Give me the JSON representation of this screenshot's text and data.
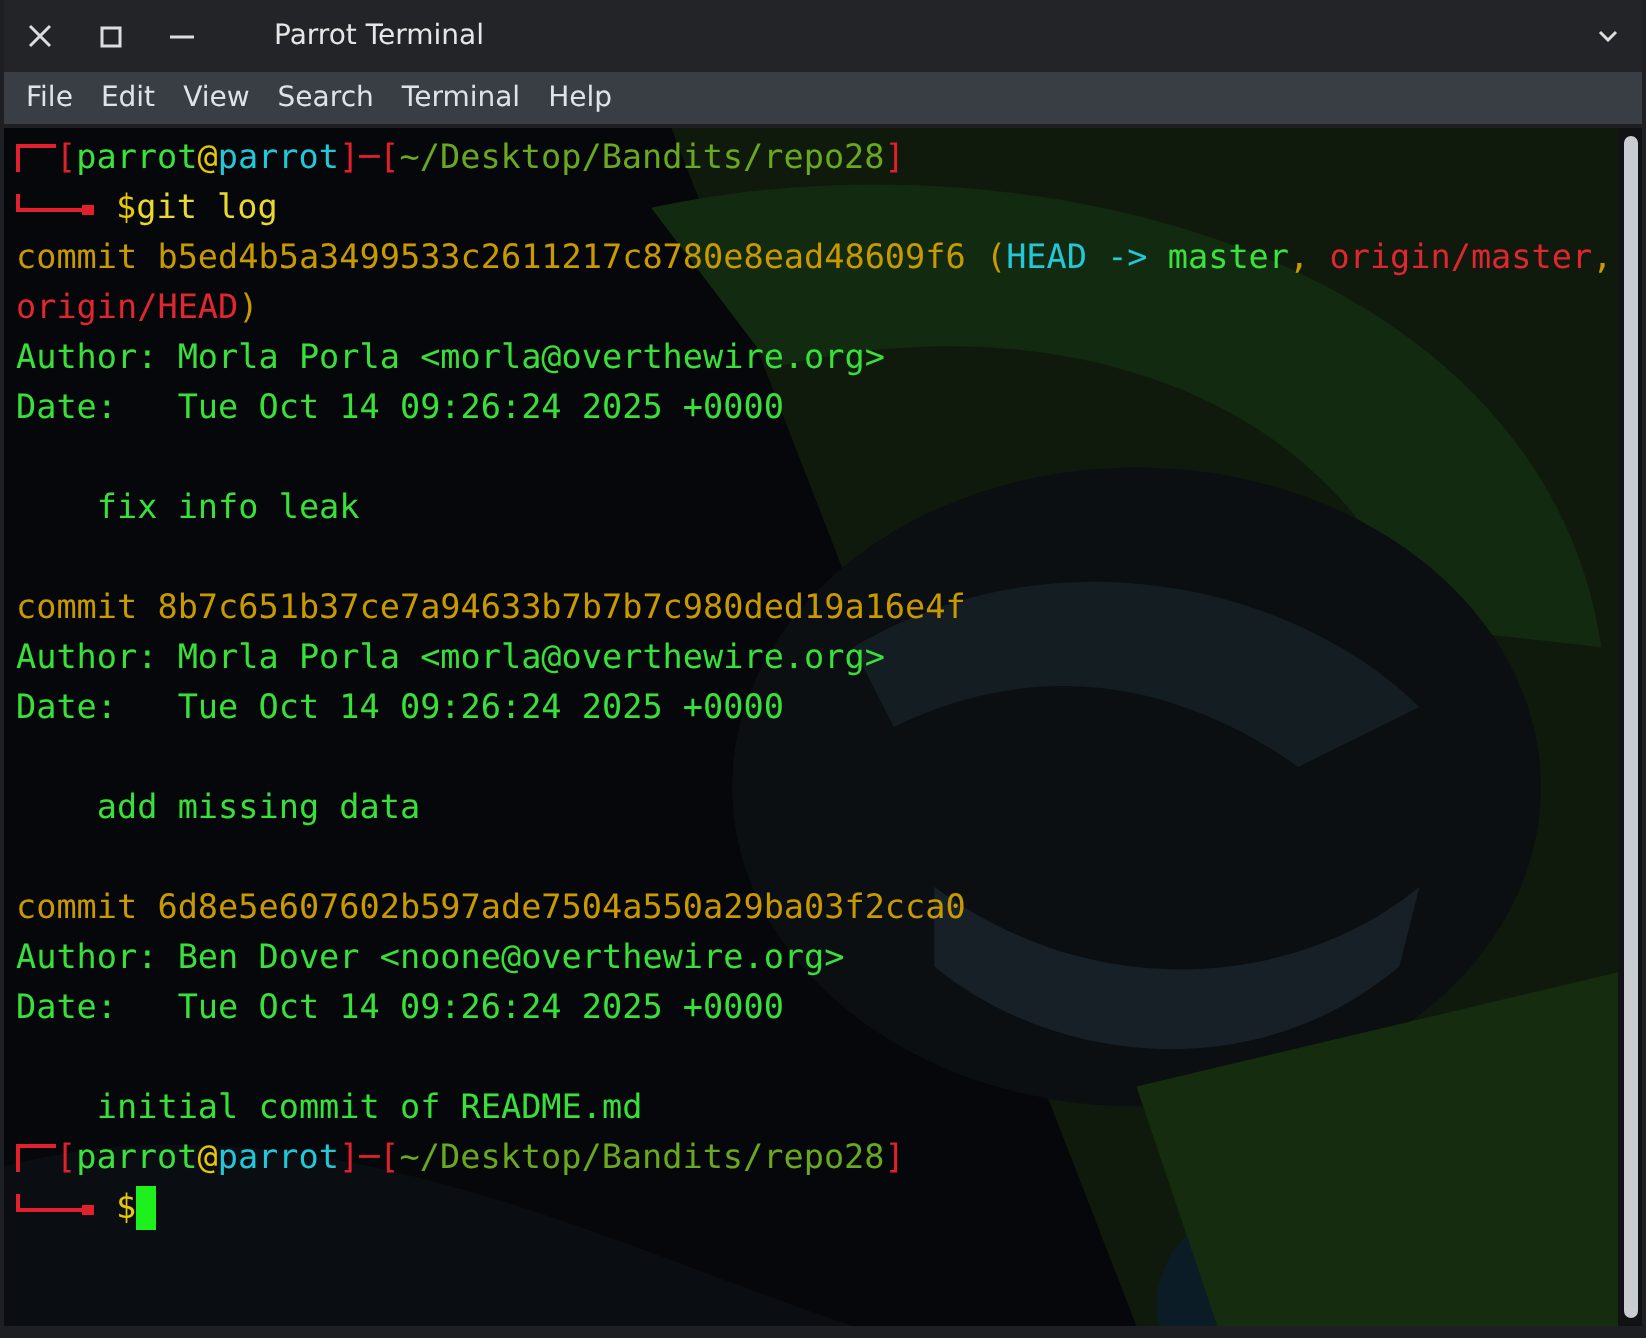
{
  "window": {
    "title": "Parrot Terminal"
  },
  "menu": [
    "File",
    "Edit",
    "View",
    "Search",
    "Terminal",
    "Help"
  ],
  "lines": [
    {
      "kind": "prompt-top",
      "segments": [
        {
          "kind": "frame",
          "text": "["
        },
        {
          "kind": "user",
          "text": "parrot"
        },
        {
          "kind": "at",
          "text": "@"
        },
        {
          "kind": "host",
          "text": "parrot"
        },
        {
          "kind": "frame",
          "text": "]─["
        },
        {
          "kind": "path",
          "text": "~/Desktop/Bandits/repo28"
        },
        {
          "kind": "frame",
          "text": "]"
        }
      ]
    },
    {
      "kind": "prompt-cmd",
      "segments": [
        {
          "kind": "at",
          "text": "$"
        },
        {
          "kind": "command",
          "text": "git log"
        }
      ]
    },
    {
      "kind": "text",
      "segments": [
        {
          "kind": "commit",
          "text": "commit b5ed4b5a3499533c2611217c8780e8ead48609f6 ("
        },
        {
          "kind": "host",
          "text": "HEAD -> "
        },
        {
          "kind": "user",
          "text": "master"
        },
        {
          "kind": "commit",
          "text": ", "
        },
        {
          "kind": "remote",
          "text": "origin/master"
        },
        {
          "kind": "commit",
          "text": ","
        }
      ]
    },
    {
      "kind": "text",
      "segments": [
        {
          "kind": "remote",
          "text": "origin/HEAD"
        },
        {
          "kind": "commit",
          "text": ")"
        }
      ]
    },
    {
      "kind": "text",
      "segments": [
        {
          "kind": "plain",
          "text": "Author: Morla Porla <morla@overthewire.org>"
        }
      ]
    },
    {
      "kind": "text",
      "segments": [
        {
          "kind": "plain",
          "text": "Date:   Tue Oct 14 09:26:24 2025 +0000"
        }
      ]
    },
    {
      "kind": "blank"
    },
    {
      "kind": "text",
      "segments": [
        {
          "kind": "plain",
          "text": "    fix info leak"
        }
      ]
    },
    {
      "kind": "blank"
    },
    {
      "kind": "text",
      "segments": [
        {
          "kind": "commit",
          "text": "commit 8b7c651b37ce7a94633b7b7b7c980ded19a16e4f"
        }
      ]
    },
    {
      "kind": "text",
      "segments": [
        {
          "kind": "plain",
          "text": "Author: Morla Porla <morla@overthewire.org>"
        }
      ]
    },
    {
      "kind": "text",
      "segments": [
        {
          "kind": "plain",
          "text": "Date:   Tue Oct 14 09:26:24 2025 +0000"
        }
      ]
    },
    {
      "kind": "blank"
    },
    {
      "kind": "text",
      "segments": [
        {
          "kind": "plain",
          "text": "    add missing data"
        }
      ]
    },
    {
      "kind": "blank"
    },
    {
      "kind": "text",
      "segments": [
        {
          "kind": "commit",
          "text": "commit 6d8e5e607602b597ade7504a550a29ba03f2cca0"
        }
      ]
    },
    {
      "kind": "text",
      "segments": [
        {
          "kind": "plain",
          "text": "Author: Ben Dover <noone@overthewire.org>"
        }
      ]
    },
    {
      "kind": "text",
      "segments": [
        {
          "kind": "plain",
          "text": "Date:   Tue Oct 14 09:26:24 2025 +0000"
        }
      ]
    },
    {
      "kind": "blank"
    },
    {
      "kind": "text",
      "segments": [
        {
          "kind": "plain",
          "text": "    initial commit of README.md"
        }
      ]
    },
    {
      "kind": "prompt-top",
      "segments": [
        {
          "kind": "frame",
          "text": "["
        },
        {
          "kind": "user",
          "text": "parrot"
        },
        {
          "kind": "at",
          "text": "@"
        },
        {
          "kind": "host",
          "text": "parrot"
        },
        {
          "kind": "frame",
          "text": "]─["
        },
        {
          "kind": "path",
          "text": "~/Desktop/Bandits/repo28"
        },
        {
          "kind": "frame",
          "text": "]"
        }
      ]
    },
    {
      "kind": "prompt-cmd",
      "cursor": true,
      "segments": [
        {
          "kind": "at",
          "text": "$"
        }
      ]
    }
  ]
}
